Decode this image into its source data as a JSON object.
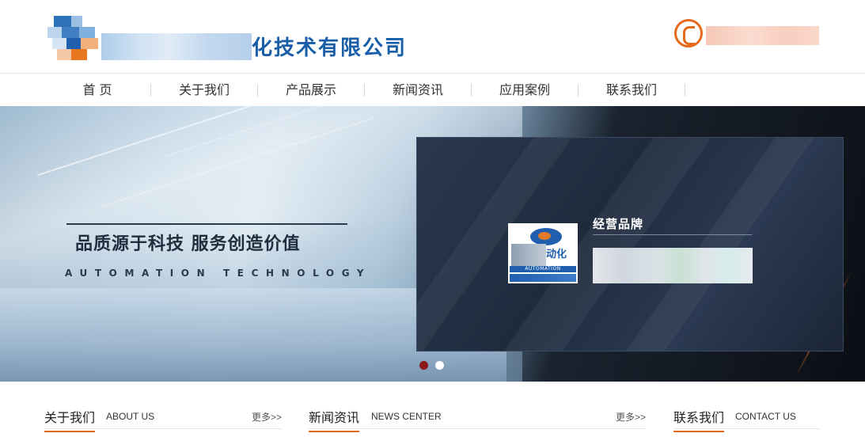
{
  "header": {
    "company_name_visible": "化技术有限公司",
    "logo_alt": "company-logo",
    "phone_icon": "phone-icon"
  },
  "nav": {
    "items": [
      {
        "label": "首 页"
      },
      {
        "label": "关于我们"
      },
      {
        "label": "产品展示"
      },
      {
        "label": "新闻资讯"
      },
      {
        "label": "应用案例"
      },
      {
        "label": "联系我们"
      }
    ]
  },
  "banner": {
    "slogan": "品质源于科技 服务创造价值",
    "sub_slogan": "AUTOMATION TECHNOLOGY",
    "brand_panel": {
      "title": "经营品牌",
      "logo_text": "动化",
      "logo_sub": "AUTOMATION"
    },
    "dots": [
      "active",
      "inactive"
    ]
  },
  "sections": {
    "about": {
      "cn": "关于我们",
      "en": "ABOUT US",
      "more": "更多>>"
    },
    "news": {
      "cn": "新闻资讯",
      "en": "NEWS CENTER",
      "more": "更多>>"
    },
    "contact": {
      "cn": "联系我们",
      "en": "CONTACT US"
    }
  },
  "colors": {
    "brand_blue": "#1a5ea7",
    "accent_orange": "#e76a1b",
    "dot_active": "#8b1a1a"
  }
}
